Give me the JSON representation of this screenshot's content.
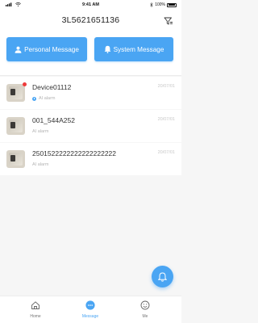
{
  "status_bar": {
    "time": "9:41 AM",
    "battery": "100%"
  },
  "header": {
    "title": "3L5621651136"
  },
  "buttons": {
    "personal": "Personal Message",
    "system": "System Message"
  },
  "messages": [
    {
      "name": "Device01112",
      "date": "20/07/01",
      "subtitle": "AI alarm",
      "unread": true,
      "sub_icon": true
    },
    {
      "name": "001_544A252",
      "date": "20/07/01",
      "subtitle": "AI alarm",
      "unread": false,
      "sub_icon": false
    },
    {
      "name": "2501522222222222222222",
      "date": "20/07/01",
      "subtitle": "AI alarm",
      "unread": false,
      "sub_icon": false
    }
  ],
  "tabs": {
    "home": "Home",
    "message": "Message",
    "me": "Me"
  },
  "colors": {
    "accent": "#4aa5f3",
    "unread": "#ee3b3b"
  }
}
